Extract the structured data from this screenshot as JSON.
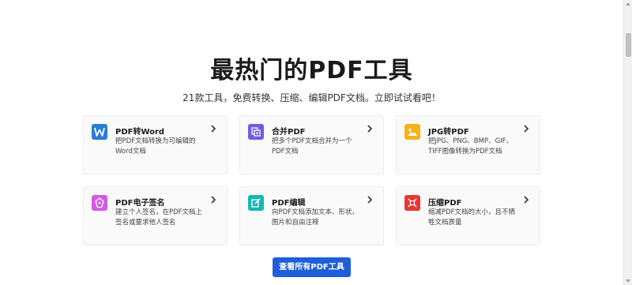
{
  "section": {
    "title": "最热门的PDF工具",
    "subtitle": "21款工具，免费转换、压缩、编辑PDF文档。立即试试看吧！"
  },
  "tools": [
    {
      "name": "PDF转Word",
      "desc": "把PDF文档转换为可编辑的Word文档",
      "icon": "word-icon",
      "color": "#2b7cd3"
    },
    {
      "name": "合并PDF",
      "desc": "把多个PDF文档合并为一个PDF文档",
      "icon": "merge-icon",
      "color": "#6c5ce7"
    },
    {
      "name": "JPG转PDF",
      "desc": "把JPG、PNG、BMP、GIF、TIFF图像转换为PDF文档",
      "icon": "image-icon",
      "color": "#f6b31a"
    },
    {
      "name": "PDF电子签名",
      "desc": "建立个人签名，在PDF文档上签名或要求他人签名",
      "icon": "signature-icon",
      "color": "#d05ce3"
    },
    {
      "name": "PDF编辑",
      "desc": "向PDF文档添加文本、形状、图片和自由注释",
      "icon": "edit-icon",
      "color": "#16b6b0"
    },
    {
      "name": "压缩PDF",
      "desc": "缩减PDF文档的大小，且不牺牲文档质量",
      "icon": "compress-icon",
      "color": "#e53935"
    }
  ],
  "cta": {
    "label": "查看所有PDF工具"
  }
}
